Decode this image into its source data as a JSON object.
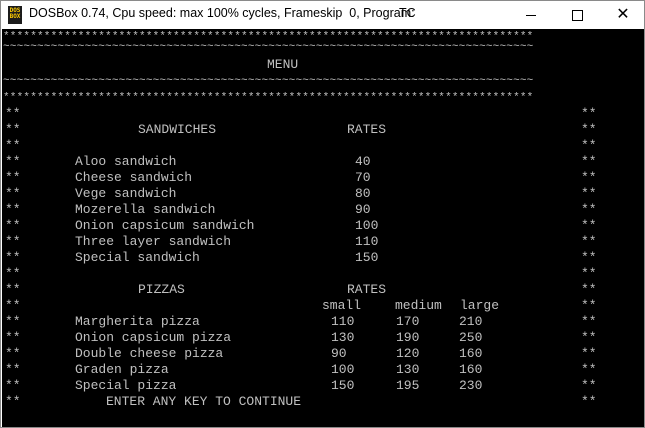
{
  "window": {
    "title": "DOSBox 0.74, Cpu speed: max 100% cycles, Frameskip  0, Program:",
    "program": "TC",
    "icon_text": "DOS\nBOX",
    "controls": {
      "minimize": "minimize-icon",
      "maximize": "maximize-icon",
      "close": "close-icon"
    }
  },
  "console": {
    "border_star": "******************************************************************************",
    "border_tilde": "~~~~~~~~~~~~~~~~~~~~~~~~~~~~~~~~~~~~~~~~~~~~~~~~~~~~~~~~~~~~~~~~~~~~~~~~~~~~~~",
    "menu_title": "MENU",
    "side_marker": "**",
    "sandwiches": {
      "heading": "SANDWICHES",
      "rates_heading": "RATES",
      "items": [
        {
          "name": "Aloo sandwich",
          "price": "40"
        },
        {
          "name": "Cheese sandwich",
          "price": "70"
        },
        {
          "name": "Vege sandwich",
          "price": "80"
        },
        {
          "name": "Mozerella sandwich",
          "price": "90"
        },
        {
          "name": "Onion capsicum sandwich",
          "price": "100"
        },
        {
          "name": "Three layer sandwich",
          "price": "110"
        },
        {
          "name": "Special sandwich",
          "price": "150"
        }
      ]
    },
    "pizzas": {
      "heading": "PIZZAS",
      "rates_heading": "RATES",
      "sizes": [
        "small",
        "medium",
        "large"
      ],
      "items": [
        {
          "name": "Margherita pizza",
          "small": "110",
          "medium": "170",
          "large": "210"
        },
        {
          "name": "Onion capsicum pizza",
          "small": "130",
          "medium": "190",
          "large": "250"
        },
        {
          "name": "Double cheese pizza",
          "small": "90",
          "medium": "120",
          "large": "160"
        },
        {
          "name": "Graden pizza",
          "small": "100",
          "medium": "130",
          "large": "160"
        },
        {
          "name": "Special pizza",
          "small": "150",
          "medium": "195",
          "large": "230"
        }
      ]
    },
    "prompt": "ENTER ANY KEY TO CONTINUE"
  }
}
